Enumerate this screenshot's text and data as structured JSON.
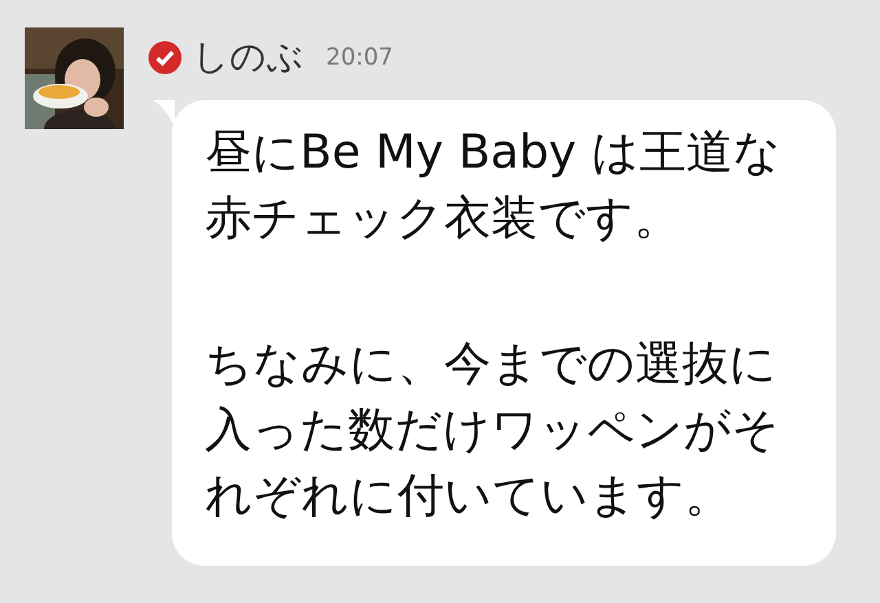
{
  "message": {
    "sender": "しのぶ",
    "verified": true,
    "time": "20:07",
    "paragraphs": [
      "昼にBe My Baby は王道な赤チェック衣装です。",
      "ちなみに、今までの選抜に入った数だけワッペンがそれぞれに付いています。"
    ]
  }
}
